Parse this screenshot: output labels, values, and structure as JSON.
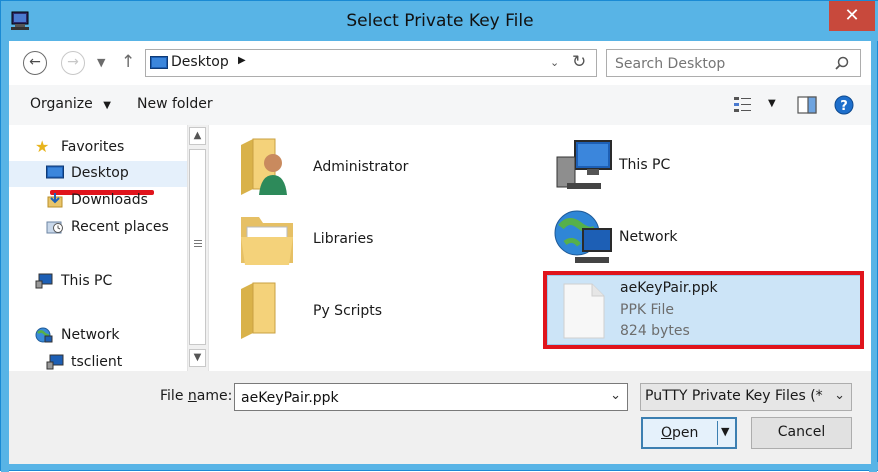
{
  "window": {
    "title": "Select Private Key File",
    "close_label": "✕"
  },
  "navbar": {
    "address": "Desktop",
    "search_placeholder": "Search Desktop"
  },
  "toolbar": {
    "organize_label": "Organize",
    "new_folder_label": "New folder"
  },
  "nav_pane": {
    "items": [
      {
        "label": "Favorites",
        "icon": "star-icon"
      },
      {
        "label": "Desktop",
        "icon": "desktop-icon",
        "selected": true
      },
      {
        "label": "Downloads",
        "icon": "downloads-icon"
      },
      {
        "label": "Recent places",
        "icon": "recent-places-icon"
      },
      {
        "label": "This PC",
        "icon": "computer-icon"
      },
      {
        "label": "Network",
        "icon": "network-icon"
      },
      {
        "label": "tsclient",
        "icon": "tsclient-icon"
      }
    ]
  },
  "files": [
    {
      "name": "Administrator",
      "icon": "user-folder-icon"
    },
    {
      "name": "Libraries",
      "icon": "libraries-folder-icon"
    },
    {
      "name": "Py Scripts",
      "icon": "folder-icon"
    },
    {
      "name": "This PC",
      "icon": "computer-icon"
    },
    {
      "name": "Network",
      "icon": "network-globe-icon"
    },
    {
      "name": "aeKeyPair.ppk",
      "type": "PPK File",
      "size": "824 bytes",
      "icon": "file-icon",
      "selected": true
    }
  ],
  "bottom": {
    "file_name_label_pre": "File ",
    "file_name_label_underline": "n",
    "file_name_label_post": "ame:",
    "file_name_value": "aeKeyPair.ppk",
    "filter_value": "PuTTY Private Key Files (*.ppk)",
    "open_label_underline": "O",
    "open_label_rest": "pen",
    "cancel_label": "Cancel"
  },
  "colors": {
    "titlebar": "#58b4e6",
    "close": "#c8493c",
    "selection": "#cce4f7",
    "annotation_red": "#e0141c"
  }
}
